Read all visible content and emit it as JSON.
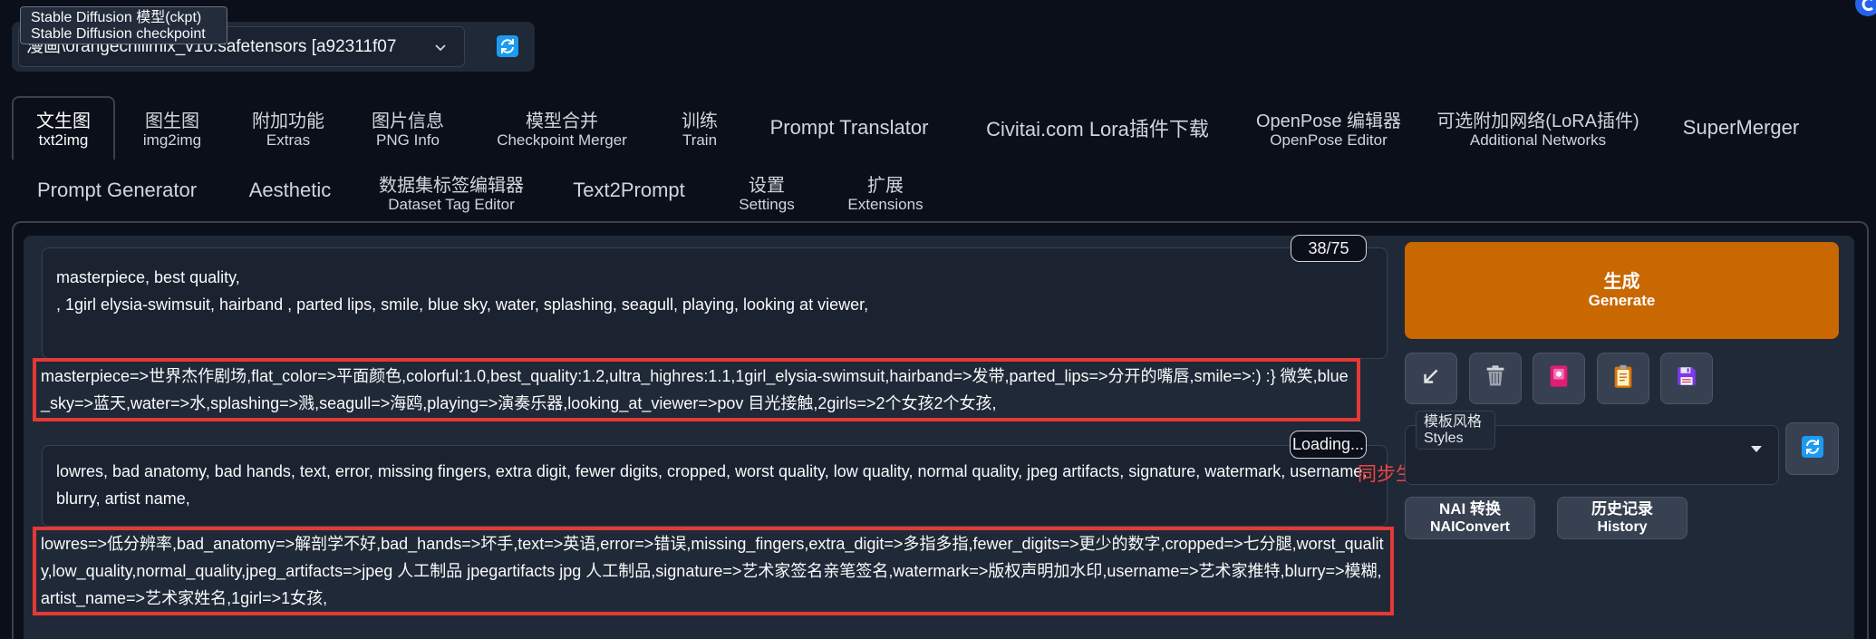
{
  "app": {
    "logo_icon": "circle-c-logo-icon"
  },
  "model_selector": {
    "value": "漫画\\orangechillmix_v10.safetensors [a92311f07",
    "tooltip": {
      "line1": "Stable Diffusion 模型(ckpt)",
      "line2": "Stable Diffusion checkpoint"
    },
    "dropdown_icon": "chevron-down-icon",
    "refresh_icon": "refresh-icon"
  },
  "tabs": {
    "row1": [
      {
        "label": "文生图",
        "sublabel": "txt2img",
        "selected": true
      },
      {
        "label": "图生图",
        "sublabel": "img2img"
      },
      {
        "label": "附加功能",
        "sublabel": "Extras"
      },
      {
        "label": "图片信息",
        "sublabel": "PNG Info"
      },
      {
        "label": "模型合并",
        "sublabel": "Checkpoint Merger"
      },
      {
        "label": "训练",
        "sublabel": "Train"
      },
      {
        "label": "Prompt Translator"
      },
      {
        "label": "Civitai.com Lora插件下载"
      },
      {
        "label": "OpenPose 编辑器",
        "sublabel": "OpenPose Editor"
      },
      {
        "label": "可选附加网络(LoRA插件)",
        "sublabel": "Additional Networks"
      },
      {
        "label": "SuperMerger"
      }
    ],
    "row2": [
      {
        "label": "Prompt Generator"
      },
      {
        "label": "Aesthetic"
      },
      {
        "label": "数据集标签编辑器",
        "sublabel": "Dataset Tag Editor"
      },
      {
        "label": "Text2Prompt"
      },
      {
        "label": "设置",
        "sublabel": "Settings"
      },
      {
        "label": "扩展",
        "sublabel": "Extensions"
      }
    ]
  },
  "txt2img": {
    "positive": {
      "text": "masterpiece, best quality,\n, 1girl elysia-swimsuit, hairband , parted lips, smile, blue sky, water, splashing, seagull, playing, looking at viewer,",
      "token_count": "38/75",
      "translation": "masterpiece=>世界杰作剧场,flat_color=>平面颜色,colorful:1.0,best_quality:1.2,ultra_highres:1.1,1girl_elysia-swimsuit,hairband=>发带,parted_lips=>分开的嘴唇,smile=>:)  :} 微笑,blue_sky=>蓝天,water=>水,splashing=>溅,seagull=>海鸥,playing=>演奏乐器,looking_at_viewer=>pov 目光接触,2girls=>2个女孩2个女孩,"
    },
    "negative": {
      "text": "lowres, bad anatomy, bad hands, text, error, missing fingers, extra digit, fewer digits, cropped, worst quality, low quality, normal quality, jpeg artifacts, signature, watermark, username, blurry, artist name,",
      "token_status": "Loading...",
      "translation": "lowres=>低分辨率,bad_anatomy=>解剖学不好,bad_hands=>坏手,text=>英语,error=>错误,missing_fingers,extra_digit=>多指多指,fewer_digits=>更少的数字,cropped=>七分腿,worst_quality,low_quality,normal_quality,jpeg_artifacts=>jpeg 人工制品 jpegartifacts jpg 人工制品,signature=>艺术家签名亲笔签名,watermark=>版权声明加水印,username=>艺术家推特,blurry=>模糊,artist_name=>艺术家姓名,1girl=>1女孩,"
    },
    "sync_label": "同步生成",
    "generate": {
      "label_cn": "生成",
      "label_en": "Generate"
    },
    "tool_buttons": [
      {
        "icon": "paste-arrow-icon"
      },
      {
        "icon": "trash-icon"
      },
      {
        "icon": "extra-networks-card-icon"
      },
      {
        "icon": "clipboard-icon"
      },
      {
        "icon": "save-icon"
      }
    ],
    "styles": {
      "label_cn": "模板风格",
      "label_en": "Styles",
      "value": "",
      "dropdown_icon": "chevron-down-icon",
      "refresh_icon": "refresh-icon"
    },
    "nai_convert": {
      "label_cn": "NAI 转换",
      "label_en": "NAIConvert"
    },
    "history": {
      "label_cn": "历史记录",
      "label_en": "History"
    }
  },
  "colors": {
    "page_bg": "#0b0f19",
    "block_bg": "#1f2937",
    "border": "#374151",
    "generate_bg": "#c96700",
    "annotation_red": "#e53935",
    "sync_label": "#ef4444",
    "refresh_blue": "#1d9bf0"
  }
}
